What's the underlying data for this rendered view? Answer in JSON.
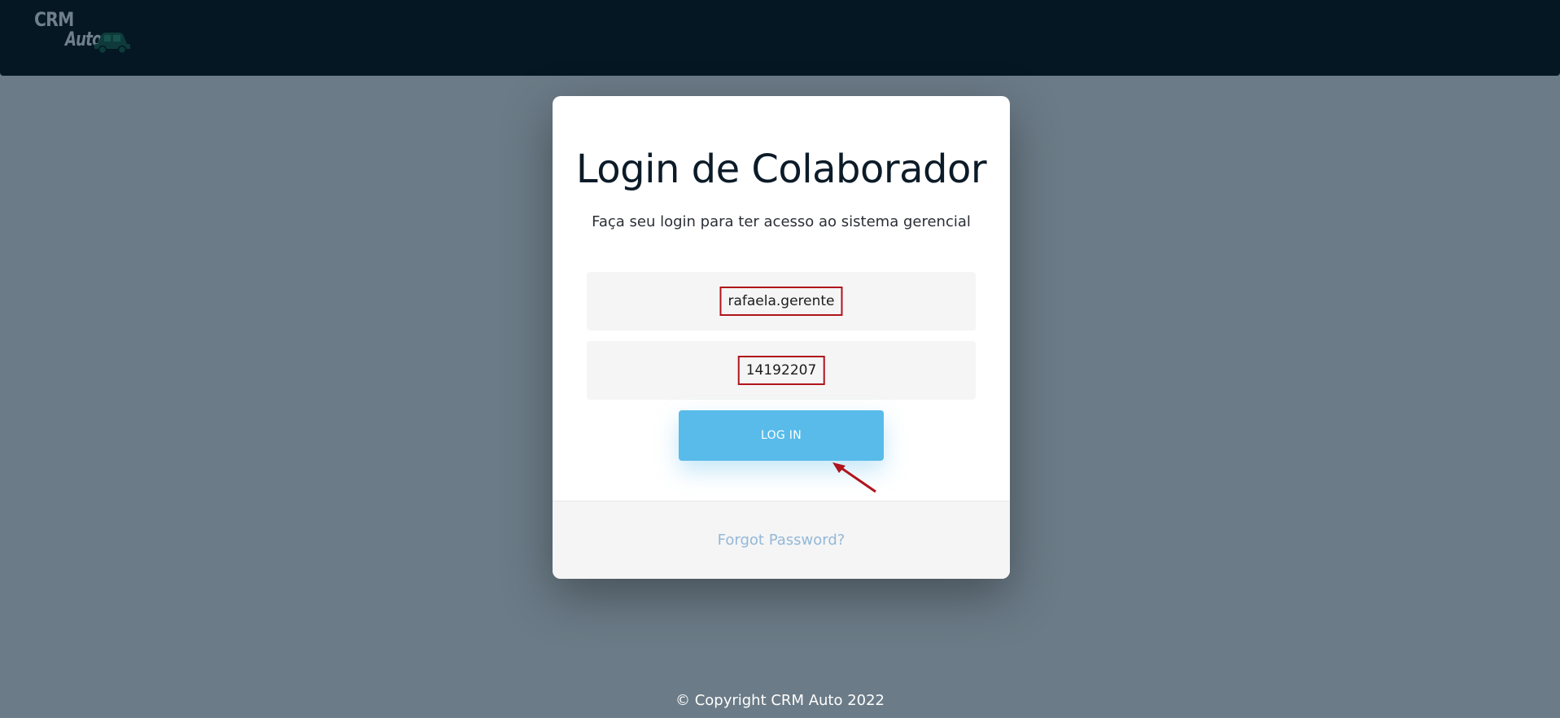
{
  "header": {
    "logo_line1": "CRM",
    "logo_line2": "Auto"
  },
  "login": {
    "title": "Login de Colaborador",
    "subtitle": "Faça seu login para ter acesso ao sistema gerencial",
    "username_value": "rafaela.gerente",
    "password_value": "14192207",
    "login_button_label": "LOG IN",
    "forgot_link": "Forgot Password?"
  },
  "footer": {
    "copyright": "© Copyright CRM Auto 2022"
  },
  "colors": {
    "topbar": "#041722",
    "background": "#6b7b87",
    "button": "#58bbea",
    "annotation": "#b0141c",
    "forgot_link": "#93b8d8"
  },
  "icons": {
    "logo_car": "car-icon",
    "annotation_arrow": "arrow-pointer-icon"
  }
}
